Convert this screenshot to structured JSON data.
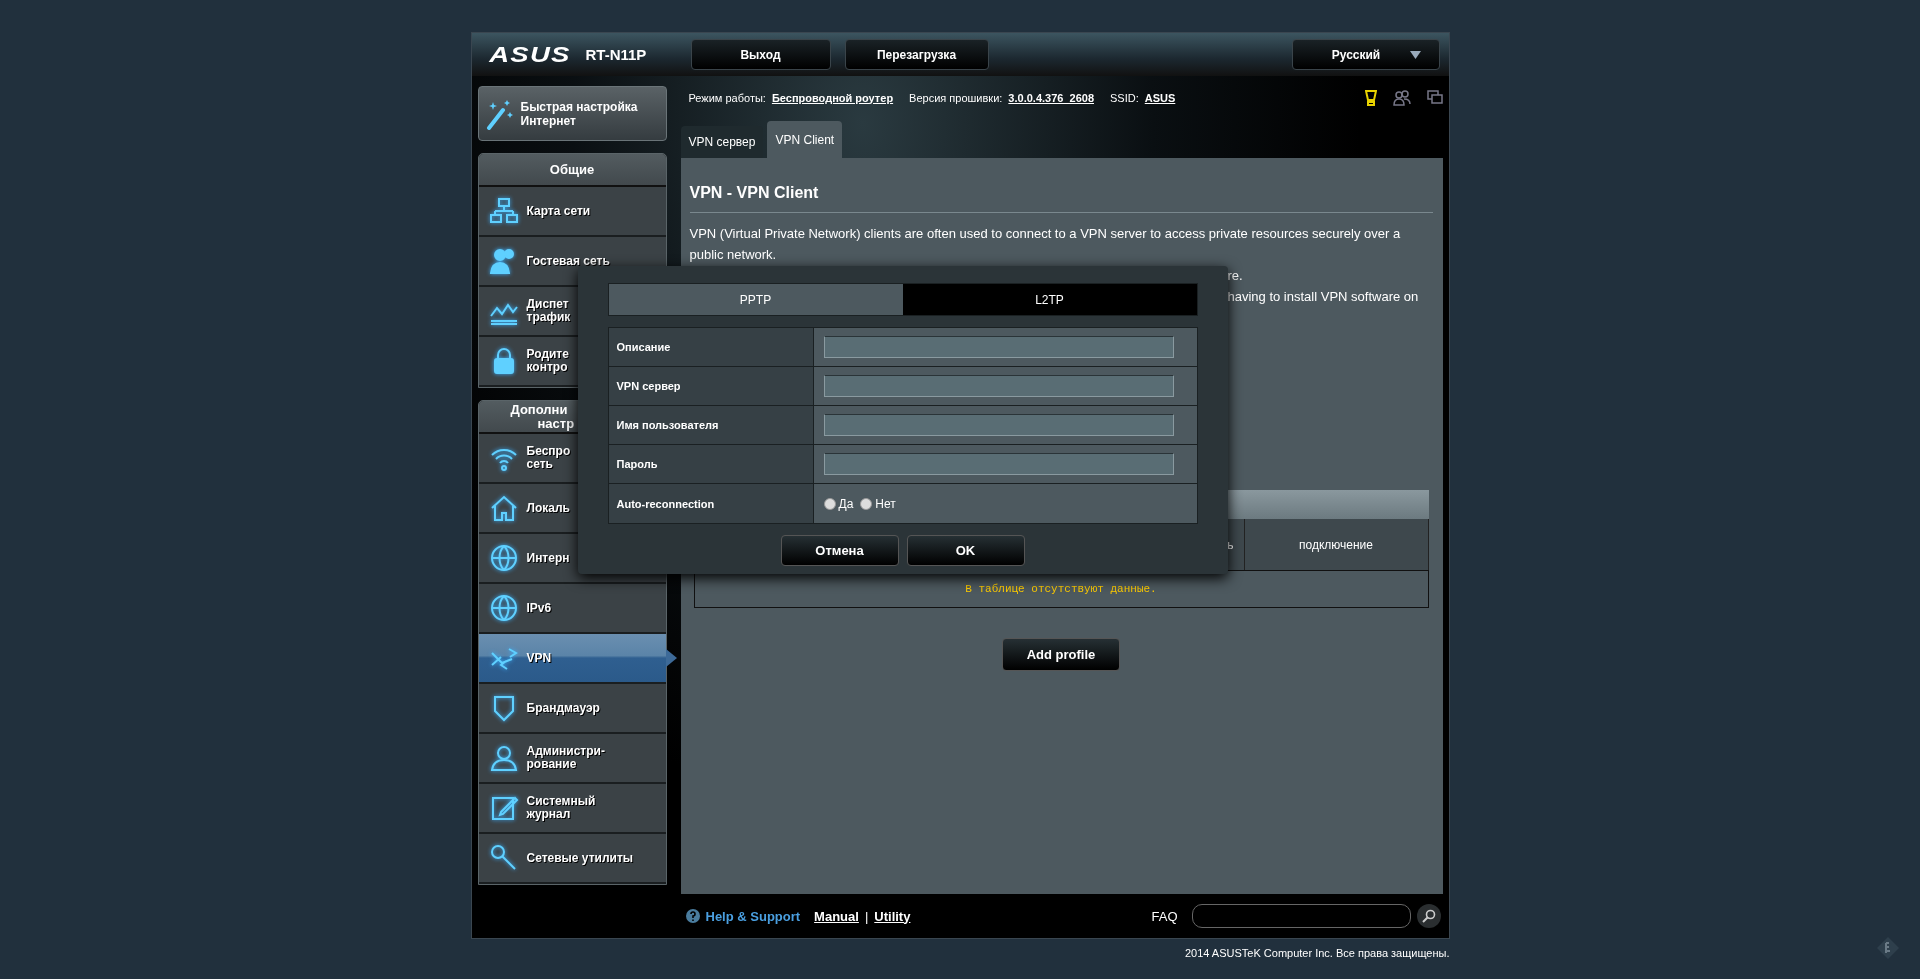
{
  "header": {
    "logo": "ASUS",
    "model": "RT-N11P",
    "buttons": [
      "Выход",
      "Перезагрузка"
    ],
    "language": "Русский"
  },
  "status": [
    {
      "label": "Режим работы:",
      "value": "Беспроводной роутер"
    },
    {
      "label": "Версия прошивки:",
      "value": "3.0.0.4.376_2608"
    },
    {
      "label": "SSID:",
      "value": "ASUS"
    }
  ],
  "quick_setup": {
    "lines": [
      "Быстрая настройка",
      "Интернет"
    ]
  },
  "sidebar": {
    "sections": [
      {
        "title_lines": [
          "Общие"
        ],
        "items": [
          {
            "lines": [
              "Карта сети"
            ],
            "selected": false
          },
          {
            "lines": [
              "Гостевая сеть"
            ],
            "selected": false
          },
          {
            "lines": [
              "Диспет",
              "трафик"
            ],
            "selected": false
          },
          {
            "lines": [
              "Родите",
              "контро"
            ],
            "selected": false
          }
        ]
      },
      {
        "title_lines": [
          "Дополни",
          "настр"
        ],
        "items": [
          {
            "lines": [
              "Беспро",
              "сеть"
            ],
            "selected": false
          },
          {
            "lines": [
              "Локаль"
            ],
            "selected": false
          },
          {
            "lines": [
              "Интерн"
            ],
            "selected": false
          },
          {
            "lines": [
              "IPv6"
            ],
            "selected": false
          },
          {
            "lines": [
              "VPN"
            ],
            "selected": true
          },
          {
            "lines": [
              "Брандмауэр"
            ],
            "selected": false
          },
          {
            "lines": [
              "Администри-",
              "рование"
            ],
            "selected": false
          },
          {
            "lines": [
              "Системный",
              "журнал"
            ],
            "selected": false
          },
          {
            "lines": [
              "Сетевые утилиты"
            ],
            "selected": false
          }
        ]
      }
    ]
  },
  "tabs": [
    {
      "label": "VPN сервер",
      "selected": false
    },
    {
      "label": "VPN Client",
      "selected": true
    }
  ],
  "content": {
    "title": "VPN - VPN Client",
    "paragraph": "VPN (Virtual Private Network) clients are often used to connect to a VPN server to access private resources securely over a public network.",
    "partial_lines": [
      "re.",
      "having to install VPN software on"
    ]
  },
  "table": {
    "columns": [
      {
        "label": "ь"
      },
      {
        "label": "подключение"
      }
    ],
    "empty_message": "В таблице отсутствуют данные."
  },
  "add_button": "Add profile",
  "modal": {
    "tabs": [
      {
        "label": "PPTP",
        "selected": false
      },
      {
        "label": "L2TP",
        "selected": true
      }
    ],
    "fields": [
      {
        "kind": "text",
        "label": "Описание"
      },
      {
        "kind": "text",
        "label": "VPN сервер"
      },
      {
        "kind": "text",
        "label": "Имя пользователя"
      },
      {
        "kind": "text",
        "label": "Пароль"
      },
      {
        "kind": "radio",
        "label": "Auto-reconnection",
        "options": [
          {
            "label": "Да",
            "selected": false
          },
          {
            "label": "Нет",
            "selected": false
          }
        ]
      }
    ],
    "buttons": [
      "Отмена",
      "OK"
    ]
  },
  "footer": {
    "help": "Help & Support",
    "links": [
      "Manual",
      "Utility"
    ],
    "separator": "|",
    "faq": "FAQ"
  },
  "copyright": "2014  ASUSTeK Computer Inc. Все права защищены."
}
